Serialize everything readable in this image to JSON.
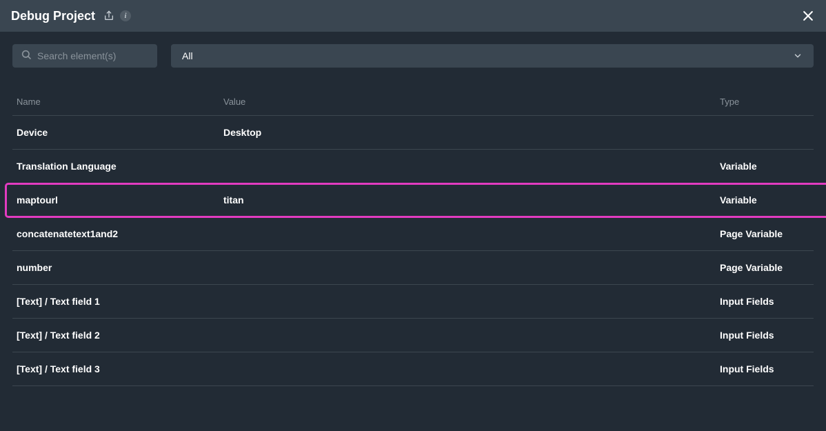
{
  "header": {
    "title": "Debug Project",
    "info_badge": "i"
  },
  "search": {
    "placeholder": "Search element(s)"
  },
  "filter": {
    "selected": "All"
  },
  "columns": {
    "name": "Name",
    "value": "Value",
    "type": "Type"
  },
  "rows": [
    {
      "name": "Device",
      "value": "Desktop",
      "type": "",
      "highlight": false
    },
    {
      "name": "Translation Language",
      "value": "",
      "type": "Variable",
      "highlight": false
    },
    {
      "name": "maptourl",
      "value": "titan",
      "type": "Variable",
      "highlight": true
    },
    {
      "name": "concatenatetext1and2",
      "value": "",
      "type": "Page Variable",
      "highlight": false
    },
    {
      "name": "number",
      "value": "",
      "type": "Page Variable",
      "highlight": false
    },
    {
      "name": "[Text] / Text field 1",
      "value": "",
      "type": "Input Fields",
      "highlight": false
    },
    {
      "name": "[Text] / Text field 2",
      "value": "",
      "type": "Input Fields",
      "highlight": false
    },
    {
      "name": "[Text] / Text field 3",
      "value": "",
      "type": "Input Fields",
      "highlight": false
    }
  ],
  "highlight_color": "#e23bc0"
}
